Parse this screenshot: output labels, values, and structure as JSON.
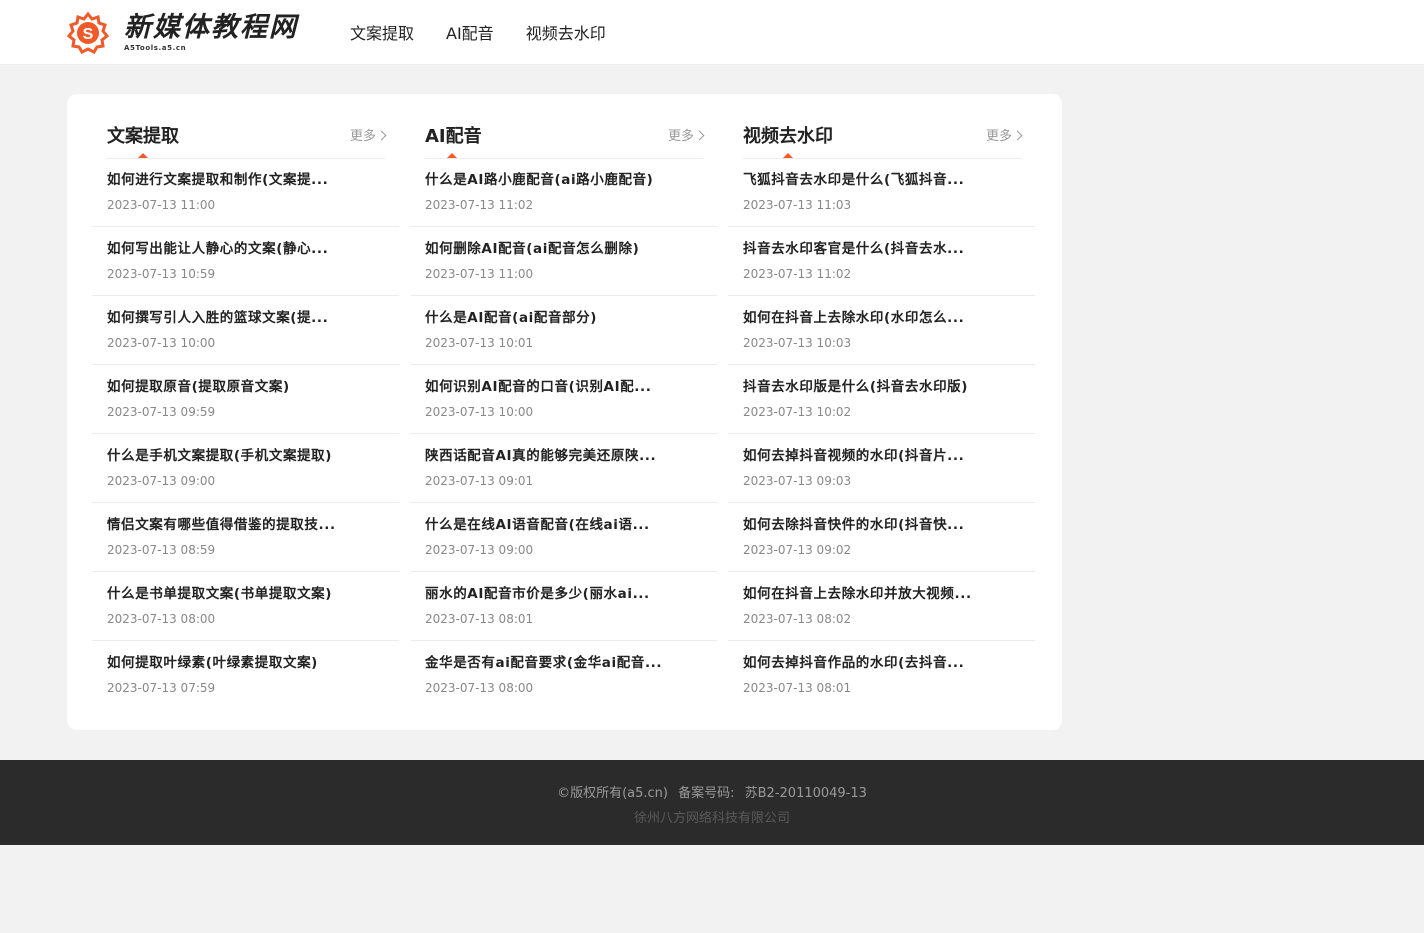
{
  "brand": {
    "name": "新媒体教程网",
    "domain_sub": "A5Tools.a5.cn",
    "accent": "#f05a28"
  },
  "nav": {
    "items": [
      {
        "label": "文案提取"
      },
      {
        "label": "AI配音"
      },
      {
        "label": "视频去水印"
      }
    ]
  },
  "sections": [
    {
      "title": "文案提取",
      "more": "更多",
      "items": [
        {
          "title": "如何进行文案提取和制作(文案提...",
          "date": "2023-07-13 11:00"
        },
        {
          "title": "如何写出能让人静心的文案(静心...",
          "date": "2023-07-13 10:59"
        },
        {
          "title": "如何撰写引人入胜的篮球文案(提...",
          "date": "2023-07-13 10:00"
        },
        {
          "title": "如何提取原音(提取原音文案)",
          "date": "2023-07-13 09:59"
        },
        {
          "title": "什么是手机文案提取(手机文案提取)",
          "date": "2023-07-13 09:00"
        },
        {
          "title": "情侣文案有哪些值得借鉴的提取技...",
          "date": "2023-07-13 08:59"
        },
        {
          "title": "什么是书单提取文案(书单提取文案)",
          "date": "2023-07-13 08:00"
        },
        {
          "title": "如何提取叶绿素(叶绿素提取文案)",
          "date": "2023-07-13 07:59"
        }
      ]
    },
    {
      "title": "AI配音",
      "more": "更多",
      "items": [
        {
          "title": "什么是AI路小鹿配音(ai路小鹿配音)",
          "date": "2023-07-13 11:02"
        },
        {
          "title": "如何删除AI配音(ai配音怎么删除)",
          "date": "2023-07-13 11:00"
        },
        {
          "title": "什么是AI配音(ai配音部分)",
          "date": "2023-07-13 10:01"
        },
        {
          "title": "如何识别AI配音的口音(识别AI配...",
          "date": "2023-07-13 10:00"
        },
        {
          "title": "陕西话配音AI真的能够完美还原陕...",
          "date": "2023-07-13 09:01"
        },
        {
          "title": "什么是在线AI语音配音(在线ai语...",
          "date": "2023-07-13 09:00"
        },
        {
          "title": "丽水的AI配音市价是多少(丽水ai...",
          "date": "2023-07-13 08:01"
        },
        {
          "title": "金华是否有ai配音要求(金华ai配音...",
          "date": "2023-07-13 08:00"
        }
      ]
    },
    {
      "title": "视频去水印",
      "more": "更多",
      "items": [
        {
          "title": "飞狐抖音去水印是什么(飞狐抖音...",
          "date": "2023-07-13 11:03"
        },
        {
          "title": "抖音去水印客官是什么(抖音去水...",
          "date": "2023-07-13 11:02"
        },
        {
          "title": "如何在抖音上去除水印(水印怎么...",
          "date": "2023-07-13 10:03"
        },
        {
          "title": "抖音去水印版是什么(抖音去水印版)",
          "date": "2023-07-13 10:02"
        },
        {
          "title": "如何去掉抖音视频的水印(抖音片...",
          "date": "2023-07-13 09:03"
        },
        {
          "title": "如何去除抖音快件的水印(抖音快...",
          "date": "2023-07-13 09:02"
        },
        {
          "title": "如何在抖音上去除水印并放大视频...",
          "date": "2023-07-13 08:02"
        },
        {
          "title": "如何去掉抖音作品的水印(去抖音...",
          "date": "2023-07-13 08:01"
        }
      ]
    }
  ],
  "footer": {
    "copyright": "©版权所有(a5.cn)",
    "icp_label": "备案号码:",
    "icp_number": "苏B2-20110049-13",
    "company": "徐州八方网络科技有限公司"
  }
}
